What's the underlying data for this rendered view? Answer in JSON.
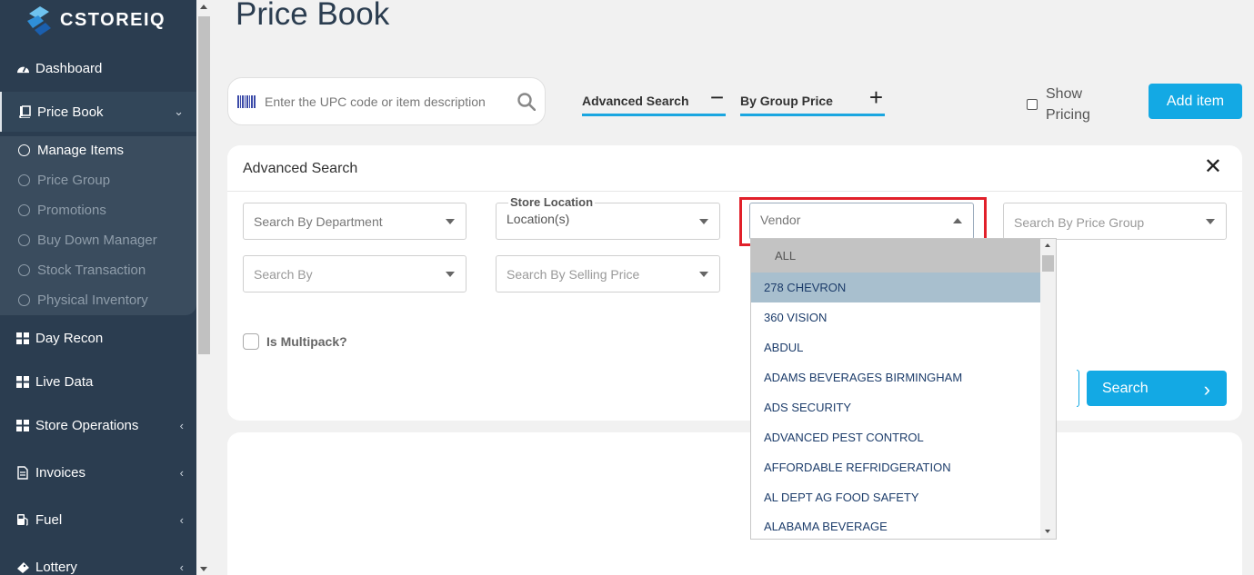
{
  "app": {
    "brand": "CSTOREIQ"
  },
  "sidebar": {
    "items": [
      {
        "label": "Dashboard",
        "icon": "tachometer-icon"
      },
      {
        "label": "Price Book",
        "icon": "book-icon",
        "expanded": true
      },
      {
        "label": "Day Recon",
        "icon": "grid-icon"
      },
      {
        "label": "Live Data",
        "icon": "grid-icon"
      },
      {
        "label": "Store Operations",
        "icon": "grid-icon"
      },
      {
        "label": "Invoices",
        "icon": "document-icon"
      },
      {
        "label": "Fuel",
        "icon": "fuel-pump-icon"
      },
      {
        "label": "Lottery",
        "icon": "ticket-icon"
      }
    ],
    "price_book_sub": [
      {
        "label": "Manage Items",
        "current": true
      },
      {
        "label": "Price Group"
      },
      {
        "label": "Promotions"
      },
      {
        "label": "Buy Down Manager"
      },
      {
        "label": "Stock Transaction"
      },
      {
        "label": "Physical Inventory"
      }
    ]
  },
  "header": {
    "title": "Price Book",
    "search_placeholder": "Enter the UPC code or item description",
    "advanced_search_label": "Advanced Search",
    "advanced_search_symbol": "−",
    "group_price_label": "By Group Price",
    "group_price_symbol": "+",
    "show_pricing_label": "Show Pricing",
    "add_item_label": "Add item"
  },
  "advanced": {
    "title": "Advanced Search",
    "close": "✕",
    "department_placeholder": "Search By Department",
    "store_location_legend": "Store Location",
    "store_location_value": "Location(s)",
    "vendor_placeholder": "Vendor",
    "price_group_placeholder": "Search By Price Group",
    "search_by_placeholder": "Search By",
    "selling_price_placeholder": "Search By Selling Price",
    "multipack_label": "Is Multipack?",
    "search_button": "Search"
  },
  "vendor_options": [
    "ALL",
    "278 CHEVRON",
    "360 VISION",
    "ABDUL",
    "ADAMS BEVERAGES BIRMINGHAM",
    "ADS SECURITY",
    "ADVANCED PEST CONTROL",
    "AFFORDABLE REFRIDGERATION",
    "AL DEPT AG FOOD SAFETY",
    "ALABAMA BEVERAGE"
  ],
  "vendor_highlighted": "278 CHEVRON",
  "colors": {
    "sidebar": "#2b3d50",
    "accent": "#13a9e4",
    "highlight_box": "#e1202a"
  }
}
